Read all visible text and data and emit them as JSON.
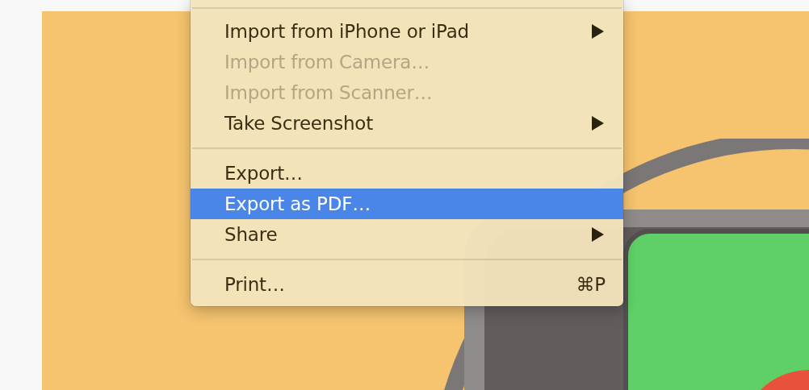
{
  "menu": {
    "items": [
      {
        "kind": "separator"
      },
      {
        "kind": "item",
        "label": "Import from iPhone or iPad",
        "disabled": false,
        "selected": false,
        "submenu": true
      },
      {
        "kind": "item",
        "label": "Import from Camera…",
        "disabled": true,
        "selected": false,
        "submenu": false
      },
      {
        "kind": "item",
        "label": "Import from Scanner…",
        "disabled": true,
        "selected": false,
        "submenu": false
      },
      {
        "kind": "item",
        "label": "Take Screenshot",
        "disabled": false,
        "selected": false,
        "submenu": true
      },
      {
        "kind": "separator"
      },
      {
        "kind": "item",
        "label": "Export…",
        "disabled": false,
        "selected": false,
        "submenu": false
      },
      {
        "kind": "item",
        "label": "Export as PDF…",
        "disabled": false,
        "selected": true,
        "submenu": false
      },
      {
        "kind": "item",
        "label": "Share",
        "disabled": false,
        "selected": false,
        "submenu": true
      },
      {
        "kind": "separator"
      },
      {
        "kind": "item",
        "label": "Print…",
        "disabled": false,
        "selected": false,
        "submenu": false,
        "shortcut": "⌘P"
      }
    ]
  }
}
